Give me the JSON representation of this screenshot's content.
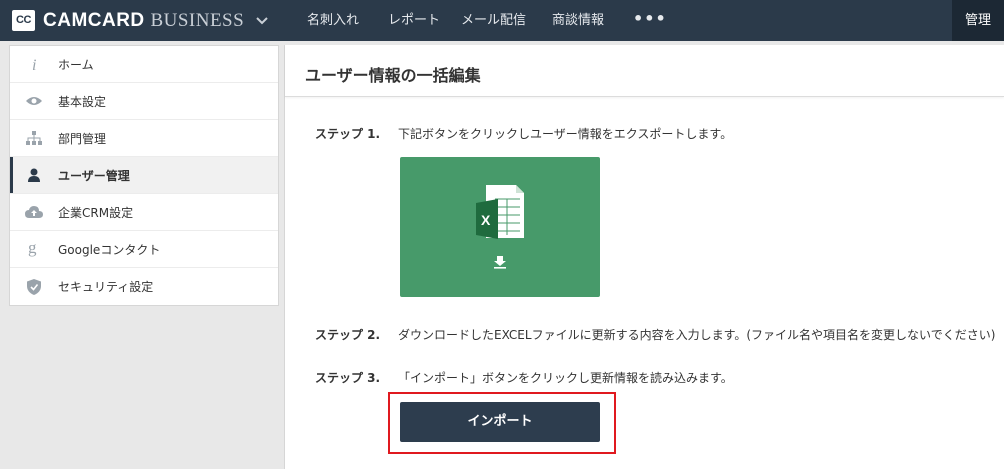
{
  "header": {
    "logo_mark": "CC",
    "logo_brand": "CAMCARD",
    "logo_product": "BUSINESS",
    "nav": [
      "名刺入れ",
      "レポート",
      "メール配信",
      "商談情報"
    ],
    "more": "•••",
    "admin": "管理"
  },
  "sidebar": {
    "items": [
      {
        "label": "ホーム",
        "icon": "info-icon"
      },
      {
        "label": "基本設定",
        "icon": "eye-icon"
      },
      {
        "label": "部門管理",
        "icon": "org-chart-icon"
      },
      {
        "label": "ユーザー管理",
        "icon": "user-icon",
        "active": true
      },
      {
        "label": "企業CRM設定",
        "icon": "cloud-upload-icon"
      },
      {
        "label": "Googleコンタクト",
        "icon": "google-icon"
      },
      {
        "label": "セキュリティ設定",
        "icon": "shield-icon"
      }
    ]
  },
  "main": {
    "title": "ユーザー情報の一括編集",
    "steps": [
      {
        "label": "ステップ 1.",
        "text": "下記ボタンをクリックしユーザー情報をエクスポートします。"
      },
      {
        "label": "ステップ 2.",
        "text": "ダウンロードしたEXCELファイルに更新する内容を入力します。(ファイル名や項目名を変更しないでください)"
      },
      {
        "label": "ステップ 3.",
        "text": "「インポート」ボタンをクリックし更新情報を読み込みます。"
      }
    ],
    "export_icon": "excel-download-icon",
    "import_label": "インポート"
  },
  "colors": {
    "topbar": "#2b3a4a",
    "export_tile": "#479a6a",
    "import_button": "#2d3d4e",
    "highlight": "#e0191f"
  }
}
